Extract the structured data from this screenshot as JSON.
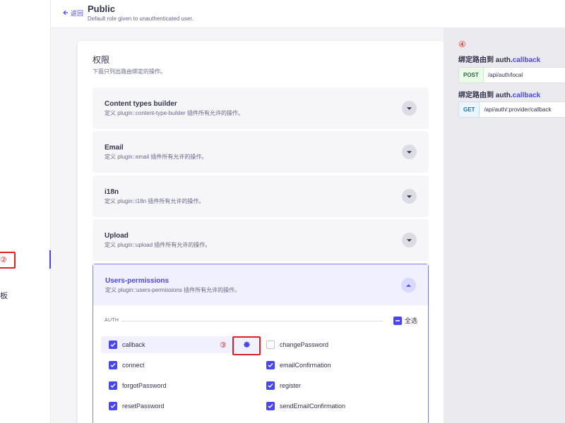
{
  "nav": {
    "active_marker": "②",
    "fragment": "板"
  },
  "header": {
    "back_label": "返回",
    "title": "Public",
    "subtitle": "Default role given to unauthenticated user."
  },
  "permissions": {
    "title": "权限",
    "description": "下面只列出路由绑定的操作。",
    "plugins": [
      {
        "name": "Content types builder",
        "description": "定义 plugin::content-type-builder 插件所有允许的操作。"
      },
      {
        "name": "Email",
        "description": "定义 plugin::email 插件所有允许的操作。"
      },
      {
        "name": "i18n",
        "description": "定义 plugin::i18n 插件所有允许的操作。"
      },
      {
        "name": "Upload",
        "description": "定义 plugin::upload 插件所有允许的操作。"
      },
      {
        "name": "Users-permissions",
        "description": "定义 plugin::users-permissions 插件所有允许的操作。"
      }
    ],
    "section_label": "AUTH",
    "select_all_label": "全选",
    "step3_marker": "③",
    "actions": [
      {
        "label": "callback",
        "checked": true
      },
      {
        "label": "changePassword",
        "checked": false
      },
      {
        "label": "connect",
        "checked": true
      },
      {
        "label": "emailConfirmation",
        "checked": true
      },
      {
        "label": "forgotPassword",
        "checked": true
      },
      {
        "label": "register",
        "checked": true
      },
      {
        "label": "resetPassword",
        "checked": true
      },
      {
        "label": "sendEmailConfirmation",
        "checked": true
      }
    ]
  },
  "routes": {
    "step4_marker": "④",
    "bindings": [
      {
        "title_prefix": "绑定路由到",
        "title_target": "auth.",
        "title_target_hl": "callback",
        "method": "POST",
        "path": "/api/auth/local"
      },
      {
        "title_prefix": "绑定路由到",
        "title_target": "auth.",
        "title_target_hl": "callback",
        "method": "GET",
        "path": "/api/auth/:provider/callback"
      }
    ]
  },
  "colors": {
    "accent": "#4945ff",
    "annotation": "#e02020"
  }
}
